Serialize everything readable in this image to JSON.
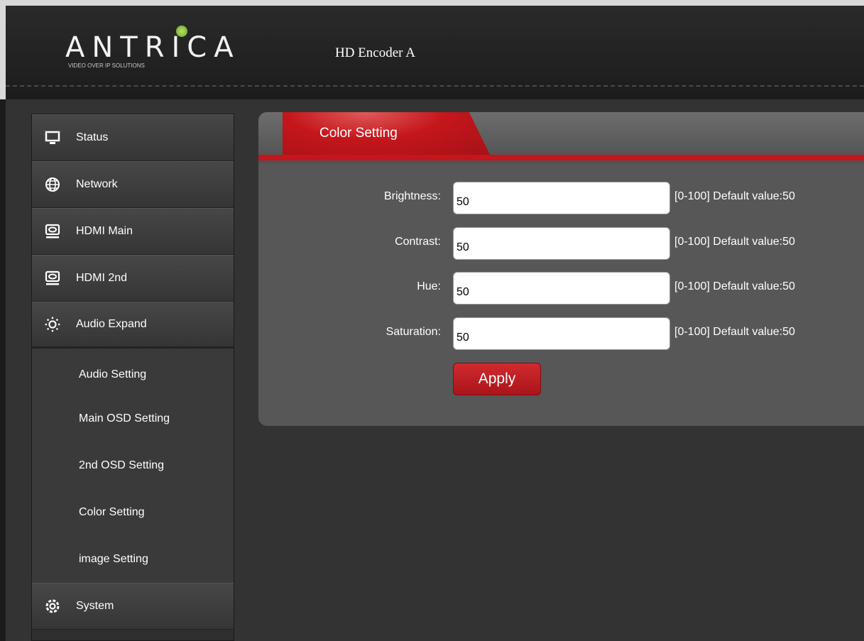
{
  "header": {
    "logo_text": "ANTRICA",
    "logo_tagline": "VIDEO OVER IP SOLUTIONS",
    "device_title": "HD Encoder  A"
  },
  "sidebar": {
    "items": [
      {
        "label": "Status",
        "icon": "monitor-icon"
      },
      {
        "label": "Network",
        "icon": "globe-icon"
      },
      {
        "label": "HDMI Main",
        "icon": "hdmi-icon"
      },
      {
        "label": "HDMI 2nd",
        "icon": "hdmi-icon"
      },
      {
        "label": "Audio Expand",
        "icon": "sun-icon"
      }
    ],
    "subitems": [
      {
        "label": "Audio Setting"
      },
      {
        "label": "Main OSD Setting"
      },
      {
        "label": "2nd OSD Setting"
      },
      {
        "label": "Color Setting"
      },
      {
        "label": "image Setting"
      }
    ],
    "bottom_item": {
      "label": "System",
      "icon": "gear-icon"
    }
  },
  "panel": {
    "tab_label": "Color Setting",
    "fields": [
      {
        "label": "Brightness:",
        "value": "50",
        "hint": "[0-100] Default value:50"
      },
      {
        "label": "Contrast:",
        "value": "50",
        "hint": "[0-100] Default value:50"
      },
      {
        "label": "Hue:",
        "value": "50",
        "hint": "[0-100] Default value:50"
      },
      {
        "label": "Saturation:",
        "value": "50",
        "hint": "[0-100] Default value:50"
      }
    ],
    "apply_label": "Apply"
  },
  "colors": {
    "accent_red": "#c4161c",
    "background": "#333333",
    "panel": "#575757",
    "logo_dot": "#8cc63f"
  }
}
